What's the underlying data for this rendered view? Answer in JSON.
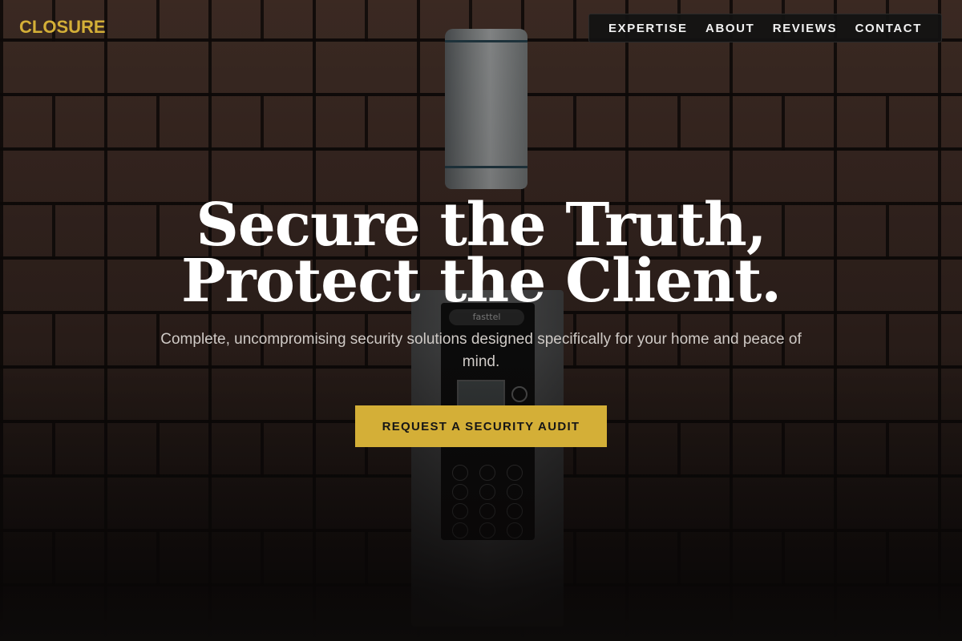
{
  "brand": {
    "logo_text": "CLOSURE",
    "accent_color": "#d4af37"
  },
  "nav": {
    "items": [
      {
        "label": "EXPERTISE"
      },
      {
        "label": "ABOUT"
      },
      {
        "label": "REVIEWS"
      },
      {
        "label": "CONTACT"
      }
    ]
  },
  "hero": {
    "headline_line1": "Secure the Truth,",
    "headline_line2": "Protect the Client.",
    "subtitle": "Complete, uncompromising security solutions designed specifically for your home and peace of mind.",
    "cta_label": "REQUEST A SECURITY AUDIT",
    "background_image": {
      "intercom_brand": "fasttel"
    }
  }
}
